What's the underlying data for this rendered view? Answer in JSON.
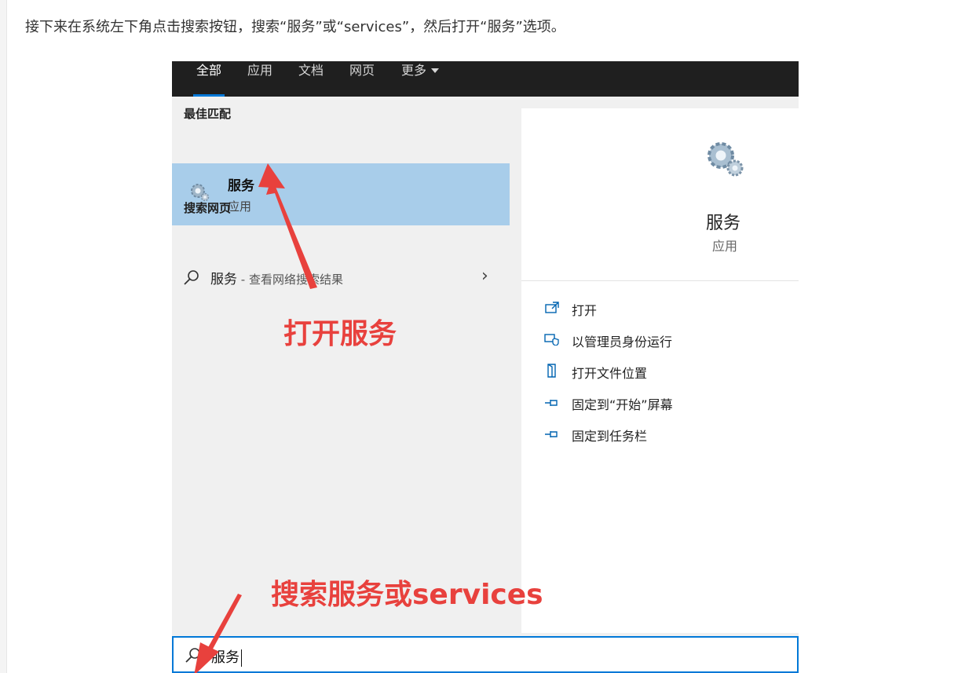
{
  "intro_text": "接下来在系统左下角点击搜索按钮，搜索“服务”或“services”，然后打开“服务”选项。",
  "tabs": [
    {
      "label": "全部",
      "active": true
    },
    {
      "label": "应用",
      "active": false
    },
    {
      "label": "文档",
      "active": false
    },
    {
      "label": "网页",
      "active": false
    },
    {
      "label": "更多",
      "active": false
    }
  ],
  "best_match": {
    "header": "最佳匹配",
    "title": "服务",
    "subtitle": "应用"
  },
  "web_search": {
    "header": "搜索网页",
    "query": "服务",
    "suffix": " - 查看网络搜索结果"
  },
  "preview": {
    "title": "服务",
    "subtitle": "应用"
  },
  "actions": [
    {
      "label": "打开",
      "icon": "open-window-icon"
    },
    {
      "label": "以管理员身份运行",
      "icon": "shield-admin-icon"
    },
    {
      "label": "打开文件位置",
      "icon": "file-location-icon"
    },
    {
      "label": "固定到“开始”屏幕",
      "icon": "pin-icon"
    },
    {
      "label": "固定到任务栏",
      "icon": "pin-icon"
    }
  ],
  "search_box": {
    "value": "服务"
  },
  "annotations": {
    "open_service": "打开服务",
    "search_hint": "搜索服务或services"
  },
  "colors": {
    "accent": "#0078d7",
    "selected": "#a8cdea",
    "annotation": "#e8413d",
    "topbar": "#1f1f1f"
  }
}
